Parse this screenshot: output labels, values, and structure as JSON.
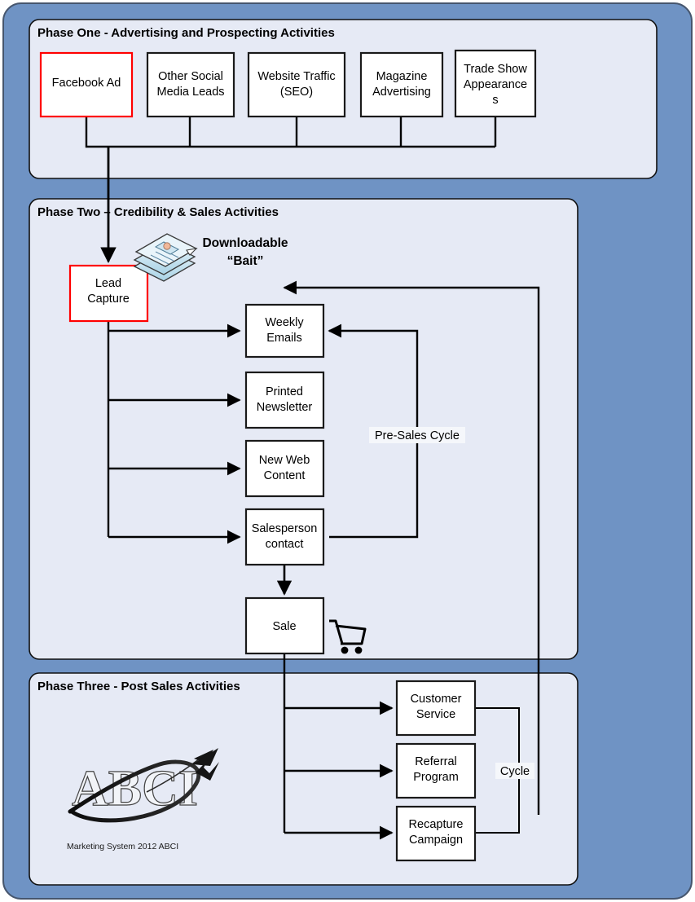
{
  "diagram": {
    "title": "ABCI Marketing System Flowchart",
    "colors": {
      "canvas_blue": "#6f93c4",
      "panel_fill": "#e6eaf5",
      "panel_border": "#1a1a1a",
      "box_fill": "#ffffff",
      "box_border": "#1a1a1a",
      "highlight_border": "#ff0000",
      "line": "#000000"
    }
  },
  "phases": [
    {
      "id": "phase-one",
      "title": "Phase One  - Advertising and Prospecting Activities",
      "boxes": [
        {
          "id": "facebook-ad",
          "lines": [
            "Facebook Ad"
          ],
          "highlighted": true
        },
        {
          "id": "other-social",
          "lines": [
            "Other Social",
            "Media Leads"
          ],
          "highlighted": false
        },
        {
          "id": "website-traffic",
          "lines": [
            "Website Traffic",
            "(SEO)"
          ],
          "highlighted": false
        },
        {
          "id": "magazine-ad",
          "lines": [
            "Magazine",
            "Advertising"
          ],
          "highlighted": false
        },
        {
          "id": "trade-show",
          "lines": [
            "Trade Show",
            "Appearance",
            "s"
          ],
          "highlighted": false
        }
      ]
    },
    {
      "id": "phase-two",
      "title": "Phase Two – Credibility & Sales Activities",
      "bait_label_line1": "Downloadable",
      "bait_label_line2": "“Bait”",
      "cycle_label": "Pre-Sales Cycle",
      "boxes": [
        {
          "id": "lead-capture",
          "lines": [
            "Lead",
            "Capture"
          ],
          "highlighted": true
        },
        {
          "id": "weekly-emails",
          "lines": [
            "Weekly",
            "Emails"
          ],
          "highlighted": false
        },
        {
          "id": "printed-newsletter",
          "lines": [
            "Printed",
            "Newsletter"
          ],
          "highlighted": false
        },
        {
          "id": "new-web-content",
          "lines": [
            "New Web",
            "Content"
          ],
          "highlighted": false
        },
        {
          "id": "salesperson-contact",
          "lines": [
            "Salesperson",
            "contact"
          ],
          "highlighted": false
        },
        {
          "id": "sale",
          "lines": [
            "Sale"
          ],
          "highlighted": false
        }
      ]
    },
    {
      "id": "phase-three",
      "title": "Phase Three -  Post Sales Activities",
      "cycle_label": "Cycle",
      "logo_caption": "Marketing System 2012 ABCI",
      "logo_letters": "ABCI",
      "boxes": [
        {
          "id": "customer-service",
          "lines": [
            "Customer",
            "Service"
          ],
          "highlighted": false
        },
        {
          "id": "referral-program",
          "lines": [
            "Referral",
            "Program"
          ],
          "highlighted": false
        },
        {
          "id": "recapture-campaign",
          "lines": [
            "Recapture",
            "Campaign"
          ],
          "highlighted": false
        }
      ]
    }
  ]
}
